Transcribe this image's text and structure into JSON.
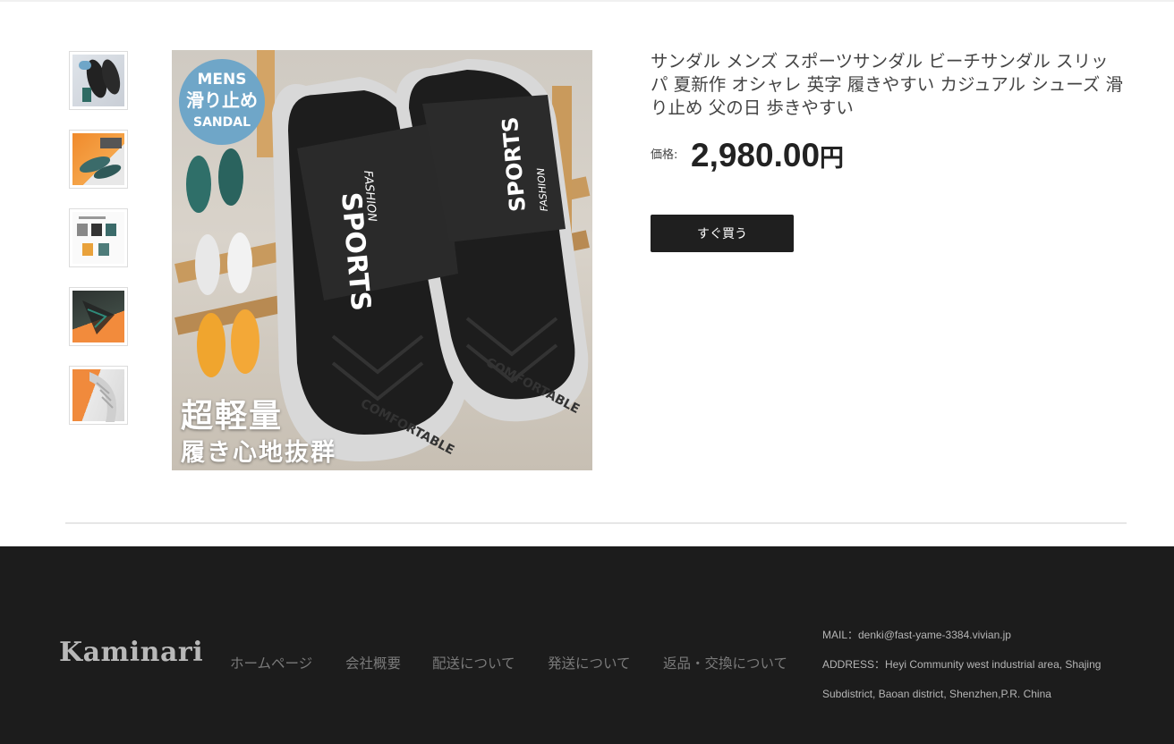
{
  "product": {
    "title": "サンダル メンズ スポーツサンダル ビーチサンダル スリッパ 夏新作 オシャレ 英字 履きやすい カジュアル シューズ 滑り止め 父の日 歩きやすい",
    "price_label": "価格:",
    "price": "2,980.00",
    "currency": "円",
    "buy_label": "すぐ買う"
  },
  "image": {
    "badge_line1": "MENS",
    "badge_line2": "滑り止め",
    "badge_line3": "SANDAL",
    "promo_line1": "超軽量",
    "promo_line2": "履き心地抜群",
    "strap_text": "SPORTS",
    "strap_sub": "FASHION",
    "sole_text": "COMFORTABLE"
  },
  "thumbnails": [
    {
      "name": "thumbnail-1"
    },
    {
      "name": "thumbnail-2"
    },
    {
      "name": "thumbnail-3"
    },
    {
      "name": "thumbnail-4"
    },
    {
      "name": "thumbnail-5"
    }
  ],
  "footer": {
    "logo": "Kaminari",
    "nav": [
      "ホームページ",
      "会社概要",
      "配送について",
      "発送について",
      "返品・交換について"
    ],
    "mail": "MAIL：denki@fast-yame-3384.vivian.jp",
    "address_line1": "ADDRESS：Heyi Community west industrial area, Shajing",
    "address_line2": "Subdistrict, Baoan district, Shenzhen,P.R. China"
  },
  "colors": {
    "button_bg": "#1f1f1f",
    "footer_bg": "#1c1c1c",
    "badge_bg": "#6fa6c8"
  }
}
